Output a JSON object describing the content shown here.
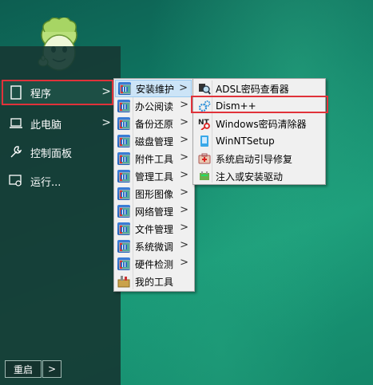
{
  "start_menu": {
    "items": [
      {
        "label": "程序",
        "icon": "document-icon"
      },
      {
        "label": "此电脑",
        "icon": "laptop-icon"
      },
      {
        "label": "控制面板",
        "icon": "wrench-icon"
      },
      {
        "label": "运行...",
        "icon": "run-icon"
      }
    ],
    "restart_label": "重启",
    "restart_arrow": ">"
  },
  "programs_menu": {
    "items": [
      {
        "label": "安装维护",
        "icon": "folder-icon"
      },
      {
        "label": "办公阅读",
        "icon": "folder-icon"
      },
      {
        "label": "备份还原",
        "icon": "folder-icon"
      },
      {
        "label": "磁盘管理",
        "icon": "folder-icon"
      },
      {
        "label": "附件工具",
        "icon": "folder-icon"
      },
      {
        "label": "管理工具",
        "icon": "folder-icon"
      },
      {
        "label": "图形图像",
        "icon": "folder-icon"
      },
      {
        "label": "网络管理",
        "icon": "folder-icon"
      },
      {
        "label": "文件管理",
        "icon": "folder-icon"
      },
      {
        "label": "系统微调",
        "icon": "folder-icon"
      },
      {
        "label": "硬件检测",
        "icon": "folder-icon"
      },
      {
        "label": "我的工具",
        "icon": "toolbox-icon"
      }
    ]
  },
  "install_menu": {
    "items": [
      {
        "label": "ADSL密码查看器",
        "icon": "magnifier-icon"
      },
      {
        "label": "Dism++",
        "icon": "gears-icon"
      },
      {
        "label": "Windows密码清除器",
        "icon": "nt-key-icon"
      },
      {
        "label": "WinNTSetup",
        "icon": "setup-icon"
      },
      {
        "label": "系统启动引导修复",
        "icon": "repair-icon"
      },
      {
        "label": "注入或安装驱动",
        "icon": "driver-icon"
      }
    ]
  },
  "colors": {
    "highlight_border": "#e0323a",
    "menu_active": "#cce4f7",
    "panel": "#163a34"
  }
}
